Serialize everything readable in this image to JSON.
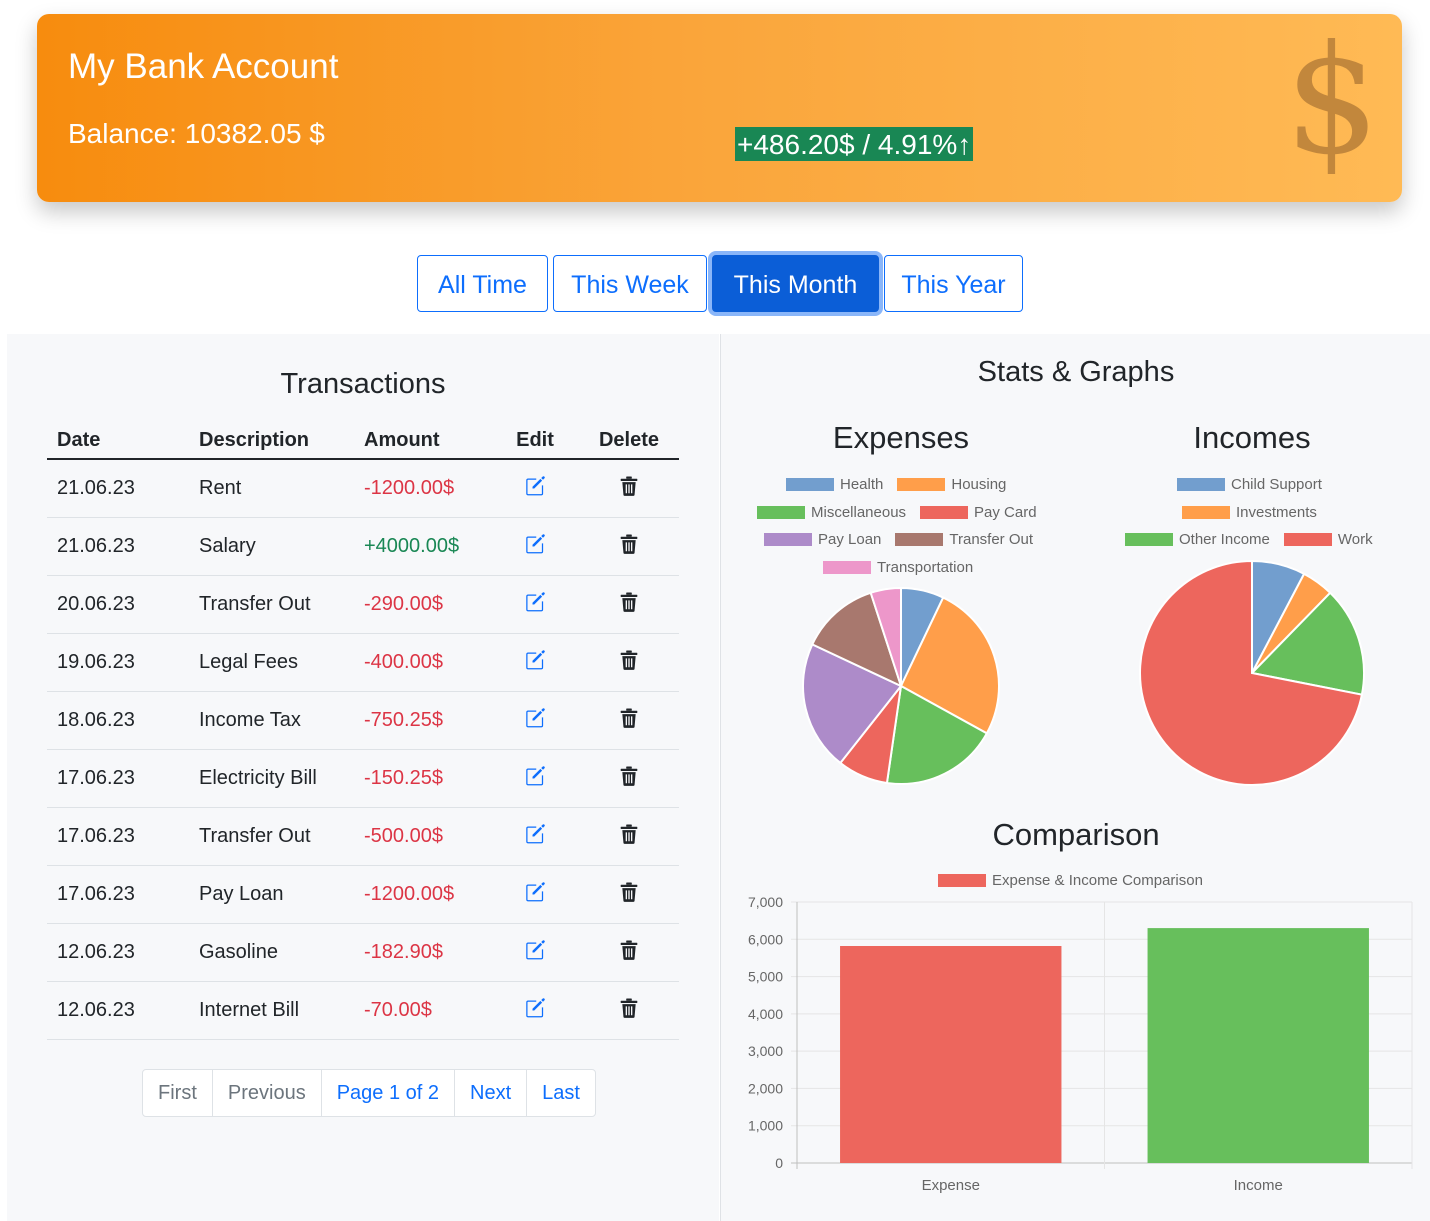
{
  "header": {
    "title": "My Bank Account",
    "balance": "Balance: 10382.05 $",
    "change": "+486.20$ / 4.91%↑",
    "currency_symbol": "$"
  },
  "filters": [
    {
      "label": "All Time",
      "active": false
    },
    {
      "label": "This Week",
      "active": false
    },
    {
      "label": "This Month",
      "active": true
    },
    {
      "label": "This Year",
      "active": false
    }
  ],
  "transactions": {
    "title": "Transactions",
    "columns": [
      "Date",
      "Description",
      "Amount",
      "Edit",
      "Delete"
    ],
    "rows": [
      {
        "date": "21.06.23",
        "description": "Rent",
        "amount": "-1200.00$",
        "type": "neg"
      },
      {
        "date": "21.06.23",
        "description": "Salary",
        "amount": "+4000.00$",
        "type": "pos"
      },
      {
        "date": "20.06.23",
        "description": "Transfer Out",
        "amount": "-290.00$",
        "type": "neg"
      },
      {
        "date": "19.06.23",
        "description": "Legal Fees",
        "amount": "-400.00$",
        "type": "neg"
      },
      {
        "date": "18.06.23",
        "description": "Income Tax",
        "amount": "-750.25$",
        "type": "neg"
      },
      {
        "date": "17.06.23",
        "description": "Electricity Bill",
        "amount": "-150.25$",
        "type": "neg"
      },
      {
        "date": "17.06.23",
        "description": "Transfer Out",
        "amount": "-500.00$",
        "type": "neg"
      },
      {
        "date": "17.06.23",
        "description": "Pay Loan",
        "amount": "-1200.00$",
        "type": "neg"
      },
      {
        "date": "12.06.23",
        "description": "Gasoline",
        "amount": "-182.90$",
        "type": "neg"
      },
      {
        "date": "12.06.23",
        "description": "Internet Bill",
        "amount": "-70.00$",
        "type": "neg"
      }
    ],
    "pagination": {
      "first": "First",
      "previous": "Previous",
      "page": "Page 1 of 2",
      "next": "Next",
      "last": "Last"
    }
  },
  "stats": {
    "title": "Stats & Graphs"
  },
  "colors": {
    "accent": "#0d6efd",
    "negative": "#dc3545",
    "positive": "#198754",
    "header_start": "#f78c0e",
    "header_end": "#ffba55"
  },
  "chart_data": [
    {
      "type": "pie",
      "title": "Expenses",
      "labels": [
        "Health",
        "Housing",
        "Miscellaneous",
        "Pay Card",
        "Pay Loan",
        "Transfer Out",
        "Transportation"
      ],
      "values": [
        6.8,
        24.9,
        18.5,
        8.0,
        20.5,
        12.5,
        4.8
      ],
      "colors": [
        "#729ece",
        "#ff9e4a",
        "#67bf5c",
        "#ed665d",
        "#ad8bc9",
        "#a8786e",
        "#ed97ca"
      ],
      "legend": "top"
    },
    {
      "type": "pie",
      "title": "Incomes",
      "labels": [
        "Child Support",
        "Investments",
        "Other Income",
        "Work"
      ],
      "values": [
        7.7,
        4.6,
        15.8,
        71.9
      ],
      "colors": [
        "#729ece",
        "#ff9e4a",
        "#67bf5c",
        "#ed665d"
      ],
      "legend": "top"
    },
    {
      "type": "bar",
      "title": "Comparison",
      "series": [
        {
          "name": "Expense & Income Comparison",
          "color": "#ed665d"
        }
      ],
      "categories": [
        "Expense",
        "Income"
      ],
      "values": [
        5820,
        6300
      ],
      "bar_colors": [
        "#ed665d",
        "#67bf5c"
      ],
      "ylim": [
        0,
        7000
      ],
      "yticks": [
        "0",
        "1,000",
        "2,000",
        "3,000",
        "4,000",
        "5,000",
        "6,000",
        "7,000"
      ],
      "grid": true,
      "legend": "top"
    }
  ]
}
